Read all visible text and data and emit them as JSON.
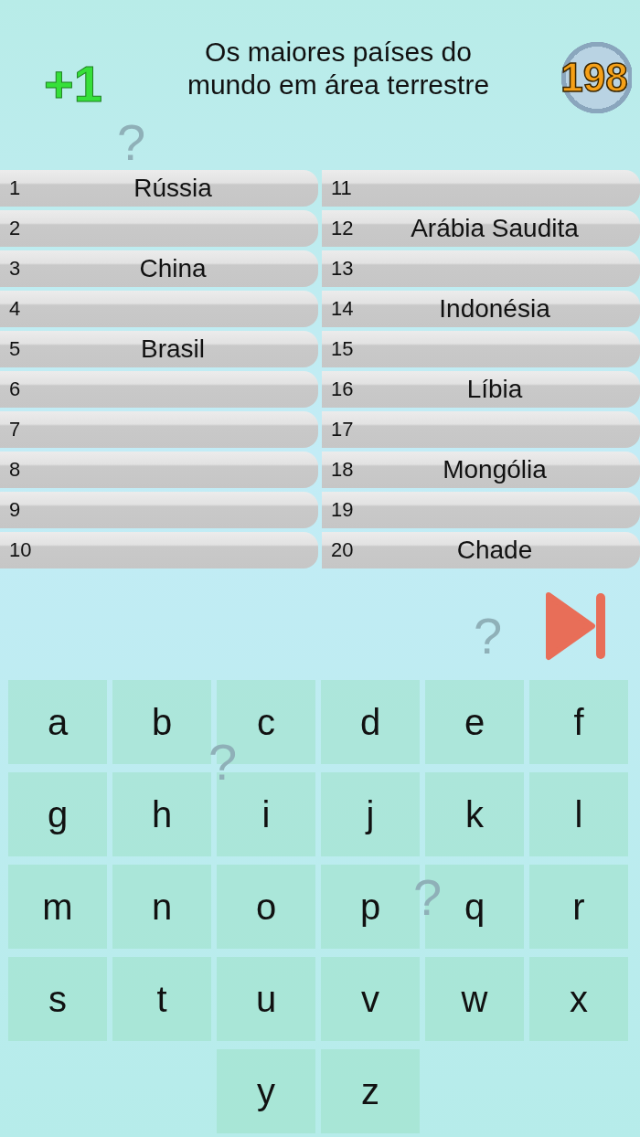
{
  "score": "+1",
  "title": "Os maiores países do mundo em área terrestre",
  "timer": "198",
  "slots": [
    {
      "number": "1",
      "answer": "Rússia"
    },
    {
      "number": "2"
    },
    {
      "number": "3",
      "answer": "China"
    },
    {
      "number": "4"
    },
    {
      "number": "5",
      "answer": "Brasil"
    },
    {
      "number": "6"
    },
    {
      "number": "7"
    },
    {
      "number": "8"
    },
    {
      "number": "9"
    },
    {
      "number": "10"
    },
    {
      "number": "11"
    },
    {
      "number": "12",
      "answer": "Arábia Saudita"
    },
    {
      "number": "13"
    },
    {
      "number": "14",
      "answer": "Indonésia"
    },
    {
      "number": "15"
    },
    {
      "number": "16",
      "answer": "Líbia"
    },
    {
      "number": "17"
    },
    {
      "number": "18",
      "answer": "Mongólia"
    },
    {
      "number": "19"
    },
    {
      "number": "20",
      "answer": "Chade"
    }
  ],
  "decorations": [
    "?",
    "?",
    "?",
    "?"
  ],
  "keys": [
    "a",
    "b",
    "c",
    "d",
    "e",
    "f",
    "g",
    "h",
    "i",
    "j",
    "k",
    "l",
    "m",
    "n",
    "o",
    "p",
    "q",
    "r",
    "s",
    "t",
    "u",
    "v",
    "w",
    "x",
    "y",
    "z"
  ]
}
